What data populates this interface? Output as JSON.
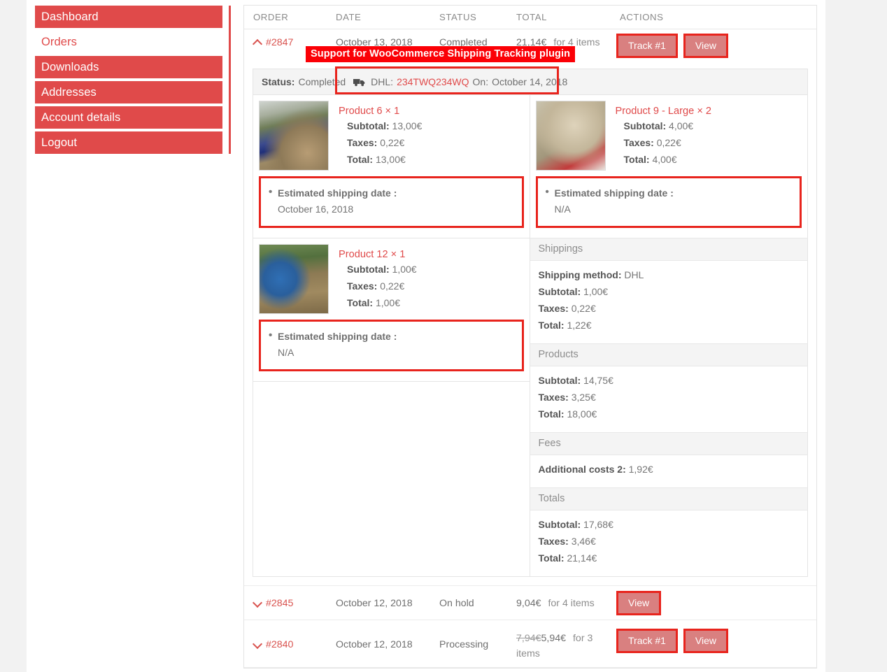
{
  "sidebar": {
    "items": [
      {
        "label": "Dashboard",
        "active": false
      },
      {
        "label": "Orders",
        "active": true
      },
      {
        "label": "Downloads",
        "active": false
      },
      {
        "label": "Addresses",
        "active": false
      },
      {
        "label": "Account details",
        "active": false
      },
      {
        "label": "Logout",
        "active": false
      }
    ]
  },
  "annotation": {
    "banner": "Support for WooCommerce Shipping Tracking plugin",
    "color": "#fb0006"
  },
  "table": {
    "headers": {
      "order": "ORDER",
      "date": "DATE",
      "status": "STATUS",
      "total": "TOTAL",
      "actions": "ACTIONS"
    }
  },
  "orders": [
    {
      "number": "#2847",
      "date": "October 13, 2018",
      "status": "Completed",
      "total_amount": "21,14€",
      "total_items": "for 4 items",
      "old_price": "",
      "expanded": true,
      "actions": [
        "Track #1",
        "View"
      ]
    },
    {
      "number": "#2845",
      "date": "October 12, 2018",
      "status": "On hold",
      "total_amount": "9,04€",
      "total_items": "for 4 items",
      "old_price": "",
      "expanded": false,
      "actions": [
        "View"
      ]
    },
    {
      "number": "#2840",
      "date": "October 12, 2018",
      "status": "Processing",
      "total_amount": "5,94€",
      "total_items": "for 3 items",
      "old_price": "7,94€",
      "expanded": false,
      "actions": [
        "Track #1",
        "View"
      ]
    }
  ],
  "detail": {
    "status_label": "Status:",
    "status_value": "Completed",
    "carrier_icon": "truck-icon",
    "carrier_label": "DHL:",
    "tracking_number": "234TWQ234WQ",
    "on_label": "On:",
    "on_date": "October 14, 2018",
    "products": [
      {
        "title": "Product 6 × 1",
        "image": "rally-car-blue-redbull",
        "subtotal_label": "Subtotal:",
        "subtotal": "13,00€",
        "taxes_label": "Taxes:",
        "taxes": "0,22€",
        "total_label": "Total:",
        "total": "13,00€",
        "esd_label": "Estimated shipping date :",
        "esd_value": "October 16, 2018"
      },
      {
        "title": "Product 9 - Large × 2",
        "image": "rally-car-red-dust",
        "subtotal_label": "Subtotal:",
        "subtotal": "4,00€",
        "taxes_label": "Taxes:",
        "taxes": "0,22€",
        "total_label": "Total:",
        "total": "4,00€",
        "esd_label": "Estimated shipping date :",
        "esd_value": "N/A"
      },
      {
        "title": "Product 12 × 1",
        "image": "rally-car-blue-gravel",
        "subtotal_label": "Subtotal:",
        "subtotal": "1,00€",
        "taxes_label": "Taxes:",
        "taxes": "0,22€",
        "total_label": "Total:",
        "total": "1,00€",
        "esd_label": "Estimated shipping date :",
        "esd_value": "N/A"
      }
    ],
    "groups": [
      {
        "title": "Shippings",
        "lines": [
          {
            "label": "Shipping method:",
            "value": "DHL"
          },
          {
            "label": "Subtotal:",
            "value": "1,00€"
          },
          {
            "label": "Taxes:",
            "value": "0,22€"
          },
          {
            "label": "Total:",
            "value": "1,22€"
          }
        ]
      },
      {
        "title": "Products",
        "lines": [
          {
            "label": "Subtotal:",
            "value": "14,75€"
          },
          {
            "label": "Taxes:",
            "value": "3,25€"
          },
          {
            "label": "Total:",
            "value": "18,00€"
          }
        ]
      },
      {
        "title": "Fees",
        "lines": [
          {
            "label": "Additional costs 2:",
            "value": "1,92€"
          }
        ]
      },
      {
        "title": "Totals",
        "lines": [
          {
            "label": "Subtotal:",
            "value": "17,68€"
          },
          {
            "label": "Taxes:",
            "value": "3,46€"
          },
          {
            "label": "Total:",
            "value": "21,14€"
          }
        ]
      }
    ]
  },
  "colors": {
    "brand_red": "#e04a4a",
    "button_red": "#d98080",
    "annotation_red": "#e8241d",
    "link_red": "#d9534f"
  }
}
